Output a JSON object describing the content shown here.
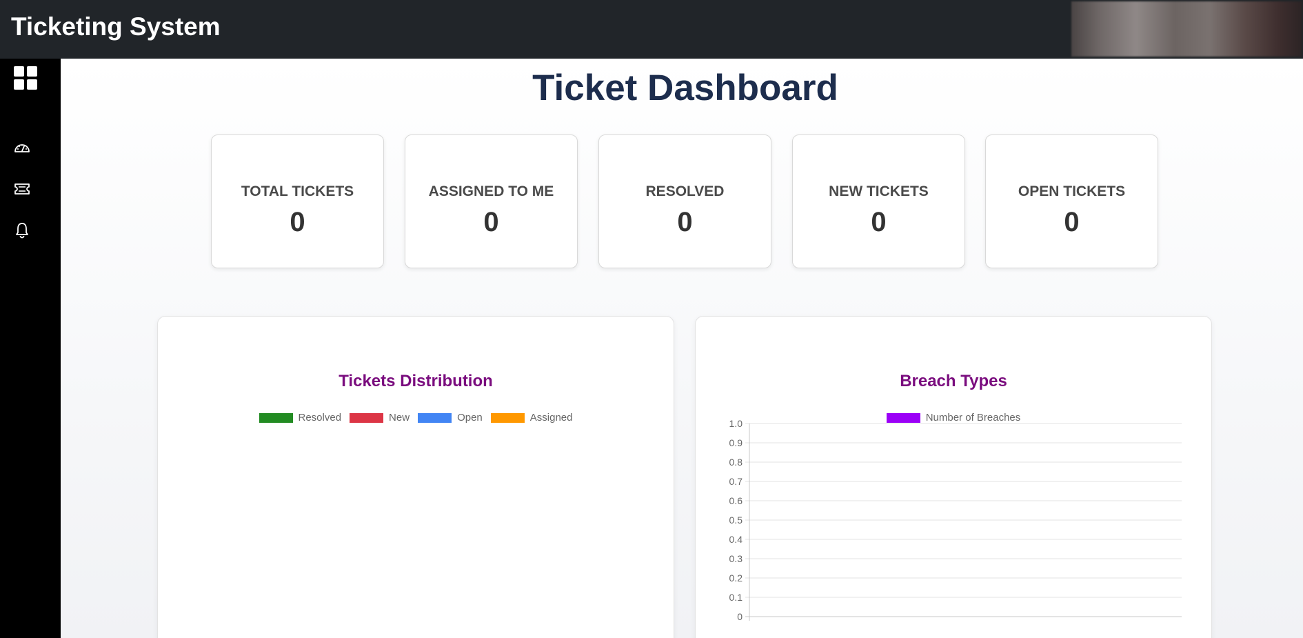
{
  "header": {
    "app_title": "Ticketing System"
  },
  "sidebar": {
    "items": [
      {
        "icon": "grid-icon"
      },
      {
        "icon": "dashboard-gauge-icon"
      },
      {
        "icon": "ticket-icon"
      },
      {
        "icon": "bell-icon"
      }
    ]
  },
  "page": {
    "title": "Ticket Dashboard"
  },
  "stats": [
    {
      "label": "TOTAL TICKETS",
      "value": "0"
    },
    {
      "label": "ASSIGNED TO ME",
      "value": "0"
    },
    {
      "label": "RESOLVED",
      "value": "0"
    },
    {
      "label": "NEW TICKETS",
      "value": "0"
    },
    {
      "label": "OPEN TICKETS",
      "value": "0"
    }
  ],
  "chart_data": [
    {
      "type": "pie",
      "title": "Tickets Distribution",
      "categories": [
        "Resolved",
        "New",
        "Open",
        "Assigned"
      ],
      "values": [
        0,
        0,
        0,
        0
      ],
      "colors": [
        "#228b22",
        "#dc3545",
        "#4285f4",
        "#ff9800"
      ],
      "legend": "top"
    },
    {
      "type": "bar",
      "title": "Breach Types",
      "categories": [],
      "series": [
        {
          "name": "Number of Breaches",
          "values": [],
          "color": "#9b00f7"
        }
      ],
      "ylim": [
        0,
        1
      ],
      "yticks": [
        "1.0",
        "0.9",
        "0.8",
        "0.7",
        "0.6",
        "0.5",
        "0.4",
        "0.3",
        "0.2",
        "0.1",
        "0"
      ],
      "grid": true,
      "legend": "top"
    }
  ]
}
